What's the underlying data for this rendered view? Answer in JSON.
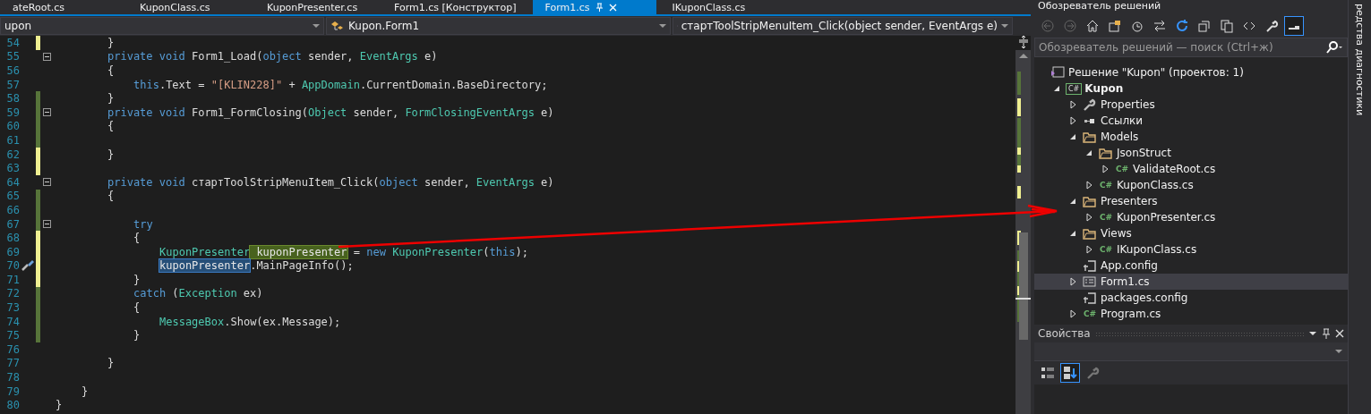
{
  "doc_tabs": [
    {
      "label": "ateRoot.cs",
      "selected": false
    },
    {
      "label": "KuponClass.cs",
      "selected": false
    },
    {
      "label": "KuponPresenter.cs",
      "selected": false
    },
    {
      "label": "Form1.cs [Конструктор]",
      "selected": false
    },
    {
      "label": "Form1.cs",
      "selected": true
    },
    {
      "label": "IKuponClass.cs",
      "selected": false
    }
  ],
  "nav_bar": {
    "project": "upon",
    "class": "Kupon.Form1",
    "member": "стартToolStripMenuItem_Click(object sender, EventArgs e)"
  },
  "code_lines": [
    {
      "children": [
        {
          "children": [
            {
              "num": "54",
              "changed": true,
              "saved": false,
              "fold": false,
              "tokens": [
                {
                  "t": "}",
                  "kind": "plain"
                }
              ]
            },
            {
              "num": "55",
              "changed": false,
              "fold": true,
              "tokens": [
                {
                  "t": "private",
                  "kind": "kw"
                },
                {
                  "t": " void",
                  "kind": "kw"
                },
                {
                  "t": " Form1_Load(",
                  "kind": "plain"
                },
                {
                  "t": "object",
                  "kind": "kw"
                },
                {
                  "t": " sender, ",
                  "kind": "plain"
                },
                {
                  "t": "EventArgs",
                  "kind": "type"
                },
                {
                  "t": " e)",
                  "kind": "plain"
                }
              ]
            },
            {
              "num": "56",
              "changed": false,
              "fold": false,
              "tokens": [
                {
                  "t": "{",
                  "kind": "plain"
                }
              ]
            },
            {
              "children": [
                {
                  "num": "57",
                  "changed": false,
                  "fold": false,
                  "tokens": [
                    {
                      "t": "this",
                      "kind": "kw"
                    },
                    {
                      "t": ".Text = ",
                      "kind": "plain"
                    },
                    {
                      "t": "\"[KLIN228]\"",
                      "kind": "str"
                    },
                    {
                      "t": " + ",
                      "kind": "plain"
                    },
                    {
                      "t": "AppDomain",
                      "kind": "type"
                    },
                    {
                      "t": ".CurrentDomain.BaseDirectory;",
                      "kind": "plain"
                    }
                  ]
                }
              ]
            },
            {
              "num": "58",
              "changed": true,
              "saved": true,
              "fold": false,
              "tokens": [
                {
                  "t": "}",
                  "kind": "plain"
                }
              ]
            },
            {
              "num": "59",
              "changed": true,
              "saved": true,
              "fold": true,
              "tokens": [
                {
                  "t": "private",
                  "kind": "kw"
                },
                {
                  "t": " void",
                  "kind": "kw"
                },
                {
                  "t": " Form1_FormClosing(",
                  "kind": "plain"
                },
                {
                  "t": "Object",
                  "kind": "type"
                },
                {
                  "t": " sender, ",
                  "kind": "plain"
                },
                {
                  "t": "FormClosingEventArgs",
                  "kind": "type"
                },
                {
                  "t": " e)",
                  "kind": "plain"
                }
              ]
            },
            {
              "num": "60",
              "changed": true,
              "saved": true,
              "fold": false,
              "tokens": [
                {
                  "t": "{",
                  "kind": "plain"
                }
              ]
            },
            {
              "num": "61",
              "changed": true,
              "saved": true,
              "fold": false
            },
            {
              "num": "62",
              "changed": true,
              "saved": false,
              "fold": false,
              "tokens": [
                {
                  "t": "}",
                  "kind": "plain"
                }
              ]
            },
            {
              "num": "63",
              "changed": true,
              "saved": false,
              "fold": false
            },
            {
              "num": "64",
              "changed": false,
              "fold": true,
              "tokens": [
                {
                  "t": "private",
                  "kind": "kw"
                },
                {
                  "t": " void",
                  "kind": "kw"
                },
                {
                  "t": " стартToolStripMenuItem_Click(",
                  "kind": "plain"
                },
                {
                  "t": "object",
                  "kind": "kw"
                },
                {
                  "t": " sender, ",
                  "kind": "plain"
                },
                {
                  "t": "EventArgs",
                  "kind": "type"
                },
                {
                  "t": " e)",
                  "kind": "plain"
                }
              ]
            },
            {
              "num": "65",
              "changed": true,
              "saved": true,
              "fold": false,
              "tokens": [
                {
                  "t": "{",
                  "kind": "plain"
                }
              ]
            },
            {
              "children": [
                {
                  "num": "66",
                  "changed": true,
                  "saved": true,
                  "fold": false
                },
                {
                  "num": "67",
                  "changed": true,
                  "saved": true,
                  "fold": true,
                  "tokens": [
                    {
                      "t": "try",
                      "kind": "kw"
                    }
                  ]
                },
                {
                  "num": "68",
                  "changed": true,
                  "saved": false,
                  "fold": false,
                  "tokens": [
                    {
                      "t": "{",
                      "kind": "plain"
                    }
                  ]
                },
                {
                  "children": [
                    {
                      "num": "69",
                      "changed": true,
                      "saved": false,
                      "fold": false,
                      "tokens": [
                        {
                          "t": "KuponPresenter",
                          "kind": "type"
                        },
                        {
                          "t": " kuponPresenter",
                          "kind": "ref"
                        },
                        {
                          "t": " = ",
                          "kind": "plain"
                        },
                        {
                          "t": "new",
                          "kind": "kw"
                        },
                        {
                          "t": " KuponPresenter",
                          "kind": "type"
                        },
                        {
                          "t": "(",
                          "kind": "plain"
                        },
                        {
                          "t": "this",
                          "kind": "kw"
                        },
                        {
                          "t": ");",
                          "kind": "plain"
                        }
                      ]
                    },
                    {
                      "num": "70",
                      "changed": true,
                      "saved": false,
                      "fold": false,
                      "quick_action": true,
                      "tokens": [
                        {
                          "t": "kuponPresenter",
                          "kind": "sel"
                        },
                        {
                          "t": ".MainPageInfo();",
                          "kind": "plain"
                        }
                      ]
                    }
                  ]
                },
                {
                  "num": "71",
                  "changed": true,
                  "saved": false,
                  "fold": false,
                  "tokens": [
                    {
                      "t": "}",
                      "kind": "plain"
                    }
                  ]
                },
                {
                  "num": "72",
                  "changed": true,
                  "saved": true,
                  "fold": false,
                  "tokens": [
                    {
                      "t": "catch",
                      "kind": "kw"
                    },
                    {
                      "t": " (",
                      "kind": "plain"
                    },
                    {
                      "t": "Exception",
                      "kind": "type"
                    },
                    {
                      "t": " ex)",
                      "kind": "plain"
                    }
                  ]
                },
                {
                  "num": "73",
                  "changed": true,
                  "saved": true,
                  "fold": false,
                  "tokens": [
                    {
                      "t": "{",
                      "kind": "plain"
                    }
                  ]
                },
                {
                  "children": [
                    {
                      "num": "74",
                      "changed": true,
                      "saved": true,
                      "fold": false,
                      "tokens": [
                        {
                          "t": "MessageBox",
                          "kind": "type"
                        },
                        {
                          "t": ".Show(ex.Message);",
                          "kind": "plain"
                        }
                      ]
                    }
                  ]
                },
                {
                  "num": "75",
                  "changed": true,
                  "saved": true,
                  "fold": false,
                  "tokens": [
                    {
                      "t": "}",
                      "kind": "plain"
                    }
                  ]
                },
                {
                  "num": "76",
                  "changed": false,
                  "fold": false
                }
              ]
            },
            {
              "num": "77",
              "changed": false,
              "fold": false,
              "tokens": [
                {
                  "t": "}",
                  "kind": "plain"
                }
              ]
            },
            {
              "num": "78",
              "changed": false,
              "fold": false
            }
          ]
        },
        {
          "num": "79",
          "changed": false,
          "fold": false,
          "tokens": [
            {
              "t": "}",
              "kind": "plain"
            }
          ]
        }
      ]
    },
    {
      "num": "80",
      "changed": false,
      "fold": false,
      "tokens": [
        {
          "t": "}",
          "kind": "plain"
        }
      ]
    }
  ],
  "solution_explorer": {
    "title": "Обозреватель решений",
    "toolbar": [
      {
        "kind": "back",
        "selected": false
      },
      {
        "kind": "forward",
        "selected": false
      },
      {
        "kind": "home",
        "selected": false
      },
      {
        "kind": "switch",
        "selected": false
      },
      {
        "kind": "history",
        "selected": false
      },
      {
        "kind": "sync",
        "selected": false
      },
      {
        "kind": "refresh",
        "selected": false
      },
      {
        "kind": "collapse",
        "selected": false
      },
      {
        "kind": "copy",
        "selected": false
      },
      {
        "kind": "code",
        "selected": false
      },
      {
        "kind": "wrench",
        "selected": false
      },
      {
        "kind": "preview",
        "selected": true
      }
    ],
    "search": {
      "placeholder": "Обозреватель решений — поиск (Ctrl+ж)"
    },
    "tree": [
      {
        "label": "Решение \"Kupon\"  (проектов: 1)",
        "kind": "solution",
        "selected": false,
        "children": [
          {
            "label": "Kupon",
            "kind": "project",
            "icon_text": "C#",
            "expanded": true,
            "selected": false,
            "children": [
              {
                "label": "Properties",
                "kind": "wrench",
                "expanded": false,
                "selected": false
              },
              {
                "label": "Ссылки",
                "kind": "refs",
                "expanded": false,
                "selected": false
              },
              {
                "label": "Models",
                "kind": "folder",
                "expanded": true,
                "selected": false,
                "children": [
                  {
                    "label": "JsonStruct",
                    "kind": "folder",
                    "expanded": true,
                    "selected": false,
                    "children": [
                      {
                        "label": "ValidateRoot.cs",
                        "kind": "cs",
                        "icon_text": "C#",
                        "expanded": false,
                        "selected": false
                      }
                    ]
                  },
                  {
                    "label": "KuponClass.cs",
                    "kind": "cs",
                    "icon_text": "C#",
                    "expanded": false,
                    "selected": false
                  }
                ]
              },
              {
                "label": "Presenters",
                "kind": "folder",
                "expanded": true,
                "selected": false,
                "children": [
                  {
                    "label": "KuponPresenter.cs",
                    "kind": "cs",
                    "icon_text": "C#",
                    "expanded": false,
                    "selected": false
                  }
                ]
              },
              {
                "label": "Views",
                "kind": "folder",
                "expanded": true,
                "selected": false,
                "children": [
                  {
                    "label": "IKuponClass.cs",
                    "kind": "cs",
                    "icon_text": "C#",
                    "expanded": false,
                    "selected": false
                  }
                ]
              },
              {
                "label": "App.config",
                "kind": "config",
                "selected": false
              },
              {
                "label": "Form1.cs",
                "kind": "form",
                "expanded": false,
                "selected": true
              },
              {
                "label": "packages.config",
                "kind": "config",
                "selected": false
              },
              {
                "label": "Program.cs",
                "kind": "cs",
                "icon_text": "C#",
                "expanded": false,
                "selected": false
              }
            ]
          }
        ]
      }
    ]
  },
  "properties": {
    "title": "Свойства",
    "toolbar": [
      {
        "kind": "categorized",
        "selected": false
      },
      {
        "kind": "alphabetical",
        "selected": true
      },
      {
        "kind": "pages",
        "selected": false
      }
    ]
  },
  "side_tab": {
    "label": "редства диагностики"
  }
}
